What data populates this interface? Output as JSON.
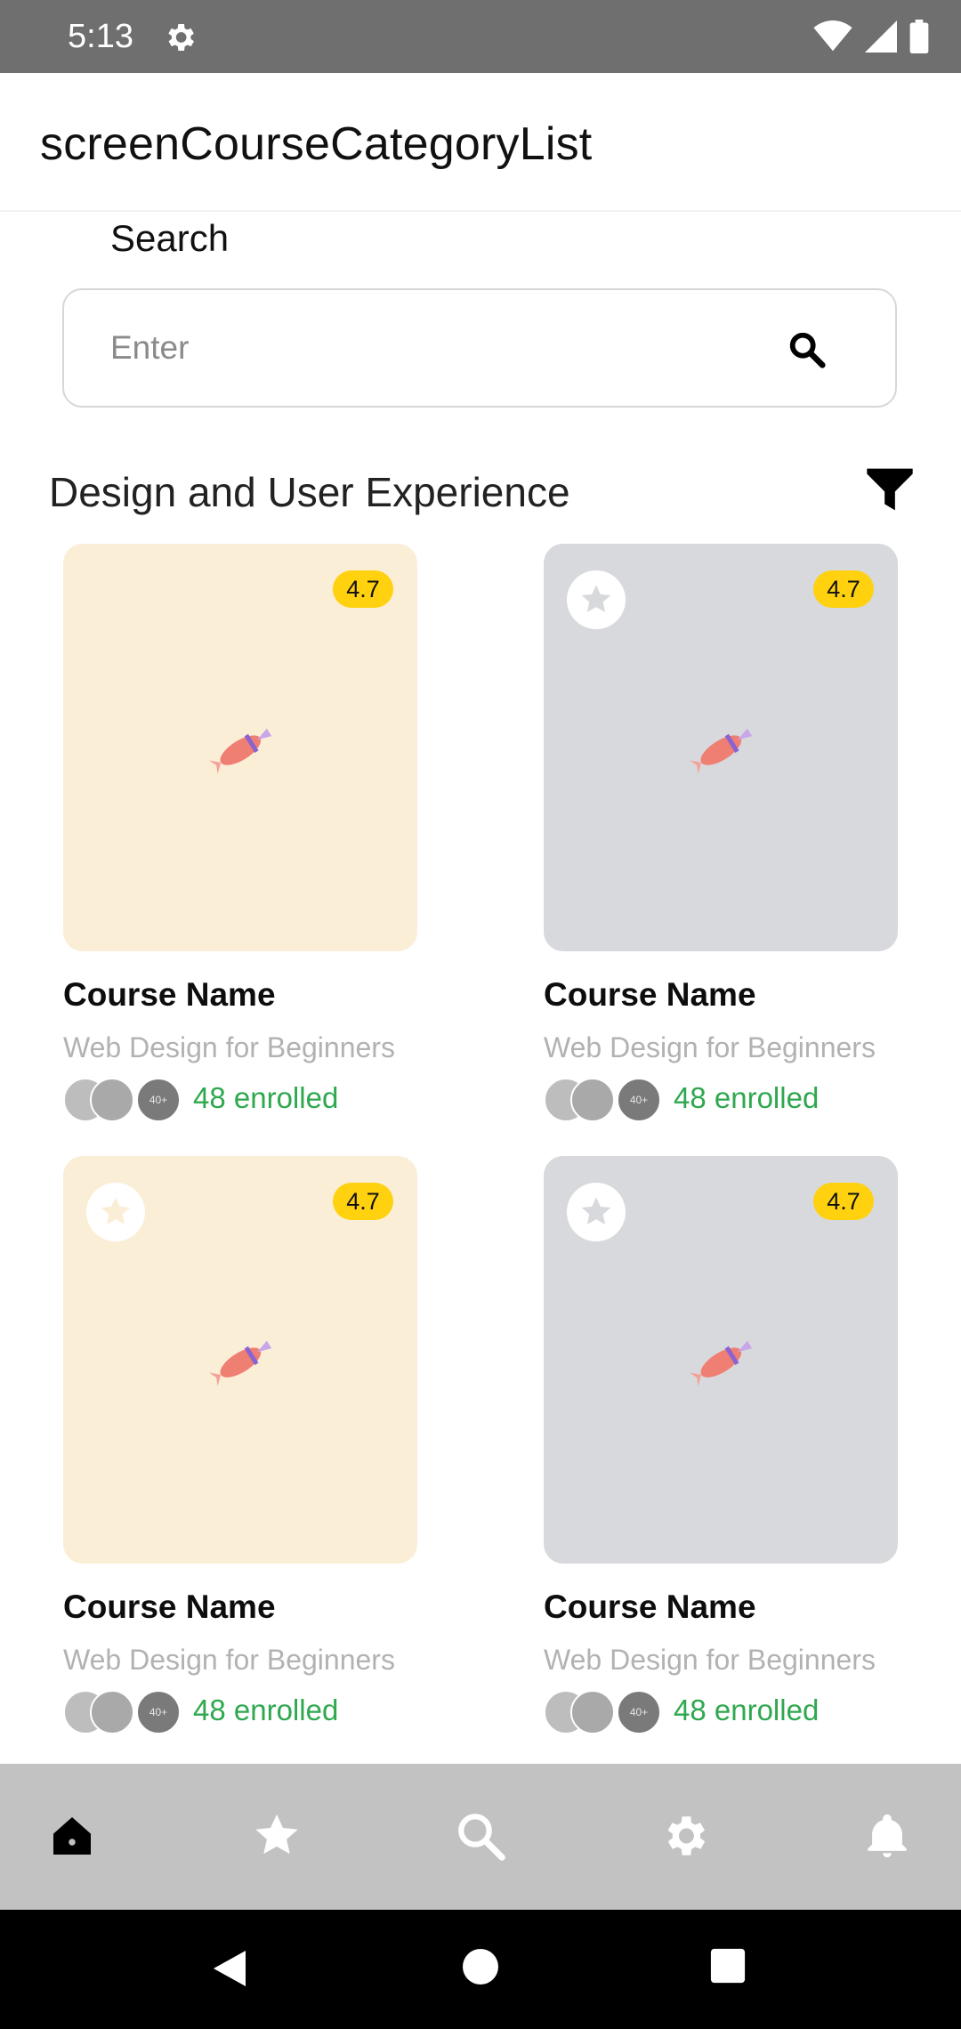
{
  "status_bar": {
    "time": "5:13"
  },
  "app_bar": {
    "title": "screenCourseCategoryList"
  },
  "search": {
    "label": "Search",
    "placeholder": "Enter"
  },
  "section": {
    "title": "Design and User Experience"
  },
  "cards": [
    {
      "rating": "4.7",
      "name": "Course Name",
      "subtitle": "Web Design for Beginners",
      "enrolled": "48 enrolled",
      "avatar_more": "40+",
      "theme": "peach",
      "has_favorite": false
    },
    {
      "rating": "4.7",
      "name": "Course Name",
      "subtitle": "Web Design for Beginners",
      "enrolled": "48 enrolled",
      "avatar_more": "40+",
      "theme": "gray",
      "has_favorite": true
    },
    {
      "rating": "4.7",
      "name": "Course Name",
      "subtitle": "Web Design for Beginners",
      "enrolled": "48 enrolled",
      "avatar_more": "40+",
      "theme": "peach",
      "has_favorite": true
    },
    {
      "rating": "4.7",
      "name": "Course Name",
      "subtitle": "Web Design for Beginners",
      "enrolled": "48 enrolled",
      "avatar_more": "40+",
      "theme": "gray",
      "has_favorite": true
    }
  ],
  "bottom_nav": {
    "items": [
      {
        "icon": "home-icon",
        "active": true
      },
      {
        "icon": "star-icon",
        "active": false
      },
      {
        "icon": "search-icon",
        "active": false
      },
      {
        "icon": "gear-icon",
        "active": false
      },
      {
        "icon": "bell-icon",
        "active": false
      }
    ]
  },
  "colors": {
    "accent_green": "#2fa84f",
    "rating_yellow": "#ffd10f",
    "card_peach": "#fbeed7",
    "card_gray": "#d8d9dc",
    "nav_bg": "#c2c2c2"
  }
}
